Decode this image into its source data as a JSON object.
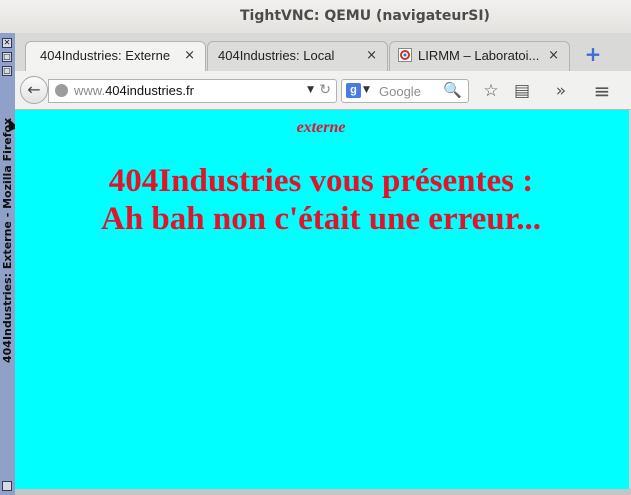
{
  "vnc_window": {
    "title": "TightVNC: QEMU (navigateurSI)"
  },
  "inner_window": {
    "side_title": "404Industries: Externe - Mozilla Firefox",
    "close_glyph": "✕",
    "minimize_glyph": "□",
    "maximize_glyph": "▢"
  },
  "tabs": [
    {
      "label": "404Industries: Externe",
      "active": true,
      "close": "×"
    },
    {
      "label": "404Industries: Local",
      "active": false,
      "close": "×"
    },
    {
      "label": "LIRMM – Laboratoi...",
      "active": false,
      "close": "×",
      "favicon": "lirmm-favicon"
    }
  ],
  "new_tab_label": "+",
  "navbar": {
    "back_glyph": "←",
    "url_prefix": "www.",
    "url_domain": "404industries.fr",
    "url_dropdown_glyph": "▼",
    "reload_glyph": "↻",
    "search_engine_letter": "g",
    "search_dropdown_glyph": "▼",
    "search_placeholder": "Google",
    "search_glyph": "🔍",
    "bookmark_glyph": "☆",
    "reading_glyph": "▤",
    "overflow_glyph": "»",
    "menu_glyph": "≡"
  },
  "page": {
    "background": "#00ffff",
    "text_color": "#e0142a",
    "subtitle": "externe",
    "heading_line1": "404Industries vous présentes :",
    "heading_line2": "Ah bah non c'était une erreur..."
  }
}
